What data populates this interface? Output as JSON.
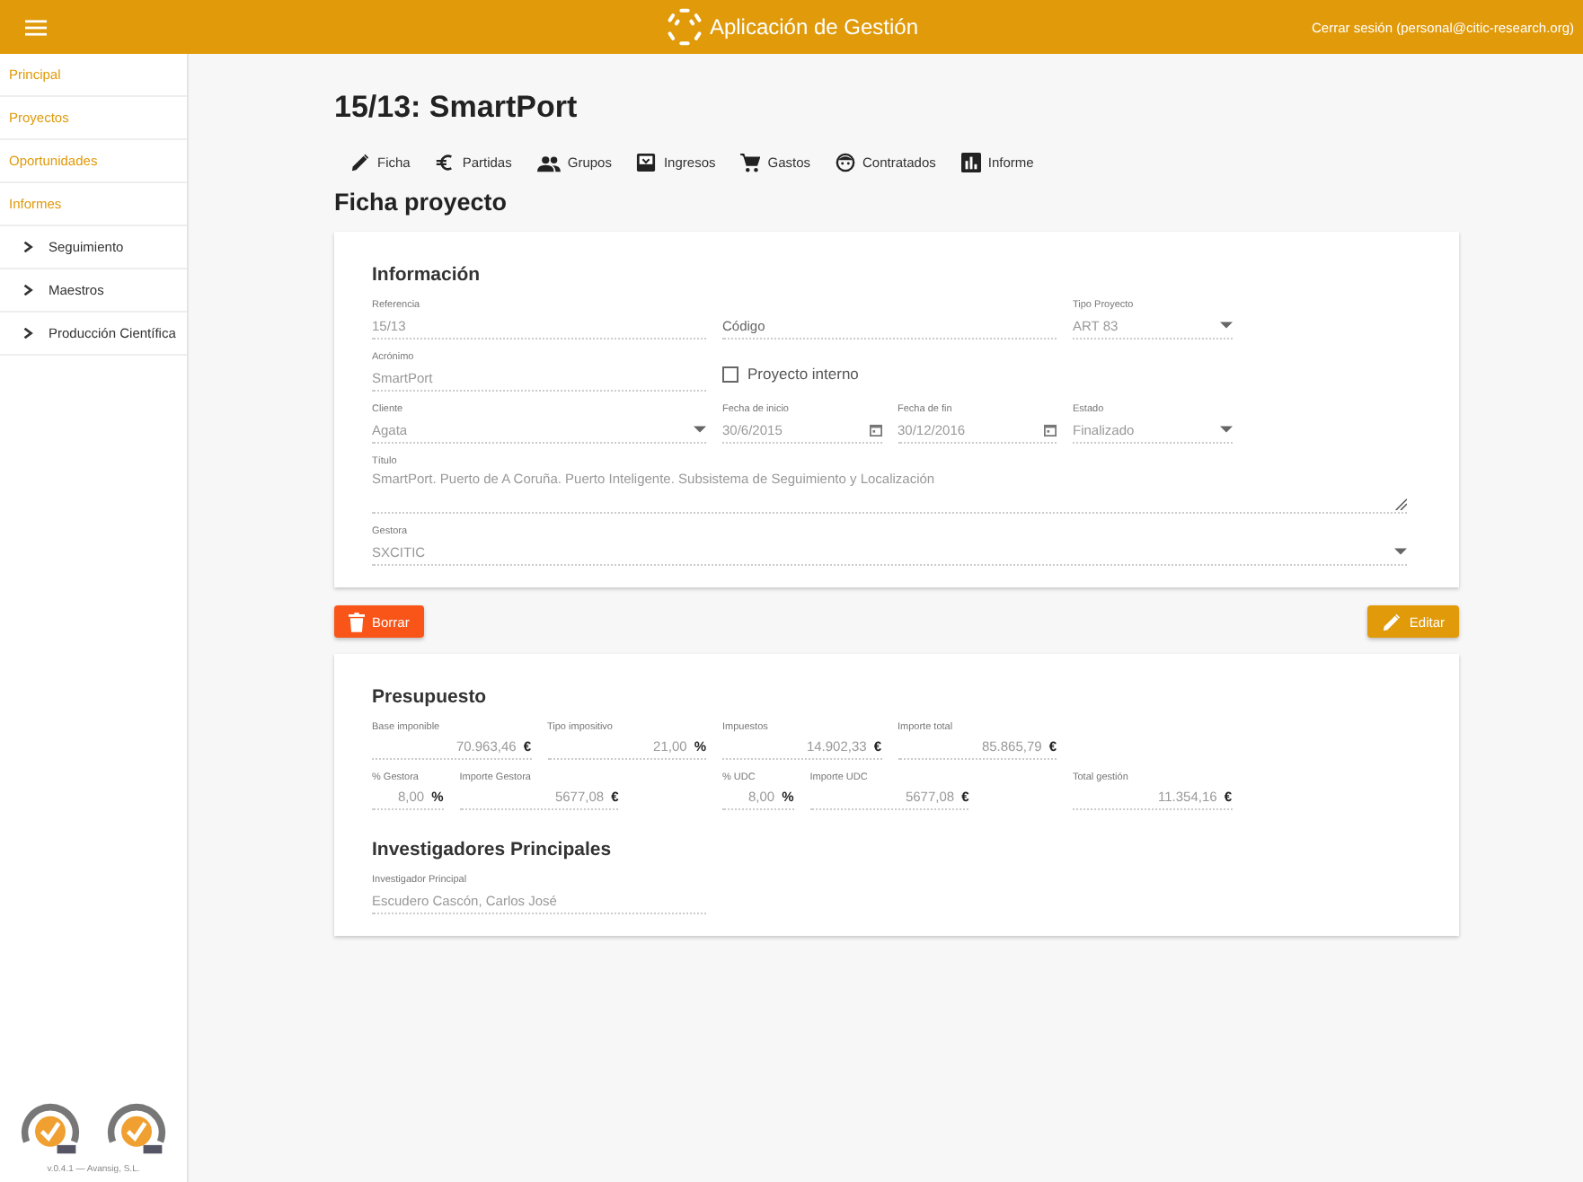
{
  "header": {
    "title": "Aplicación de Gestión",
    "logout": "Cerrar sesión (personal@citic-research.org)"
  },
  "sidebar": {
    "items": [
      {
        "label": "Principal"
      },
      {
        "label": "Proyectos"
      },
      {
        "label": "Oportunidades"
      },
      {
        "label": "Informes",
        "children": [
          {
            "label": "Seguimiento",
            "expanded": false
          },
          {
            "label": "Maestros",
            "expanded": false
          },
          {
            "label": "Producción Científica",
            "expanded": false
          }
        ]
      }
    ],
    "footer": "v.0.4.1 — Avansig, S.L."
  },
  "page_title": "15/13: SmartPort",
  "tabs": [
    {
      "label": "Ficha",
      "kind": "pencil"
    },
    {
      "label": "Partidas",
      "kind": "euro"
    },
    {
      "label": "Grupos",
      "kind": "group"
    },
    {
      "label": "Ingresos",
      "kind": "inbox"
    },
    {
      "label": "Gastos",
      "kind": "cart"
    },
    {
      "label": "Contratados",
      "kind": "face"
    },
    {
      "label": "Informe",
      "kind": "chart"
    }
  ],
  "section_title": "Ficha proyecto",
  "info": {
    "title": "Información",
    "fields": [
      {
        "kind": "text",
        "label": "Referencia",
        "value": "15/13"
      },
      {
        "kind": "text",
        "placeholder": "Código"
      },
      {
        "kind": "select",
        "label": "Tipo Proyecto",
        "value": "ART 83"
      },
      {
        "kind": "text",
        "label": "Acrónimo",
        "value": "SmartPort"
      },
      {
        "kind": "checkbox",
        "label": "Proyecto interno",
        "checked": false
      },
      {
        "kind": "select",
        "label": "Cliente",
        "value": "Agata"
      },
      {
        "kind": "date",
        "label": "Fecha de inicio",
        "value": "30/6/2015"
      },
      {
        "kind": "date",
        "label": "Fecha de fin",
        "value": "30/12/2016"
      },
      {
        "kind": "select",
        "label": "Estado",
        "value": "Finalizado"
      },
      {
        "kind": "textarea",
        "label": "Título",
        "value": "SmartPort. Puerto de A Coruña. Puerto Inteligente. Subsistema de Seguimiento y Localización"
      },
      {
        "kind": "select",
        "label": "Gestora",
        "value": "SXCITIC"
      }
    ]
  },
  "buttons": {
    "delete": "Borrar",
    "edit": "Editar"
  },
  "budget": {
    "title": "Presupuesto",
    "fields": [
      {
        "label": "Base imponible",
        "value": "70.963,46",
        "unit": "€"
      },
      {
        "label": "Tipo impositivo",
        "value": "21,00",
        "unit": "%"
      },
      {
        "label": "Impuestos",
        "value": "14.902,33",
        "unit": "€"
      },
      {
        "label": "Importe total",
        "value": "85.865,79",
        "unit": "€"
      },
      {
        "label": "% Gestora",
        "value": "8,00",
        "unit": "%"
      },
      {
        "label": "Importe Gestora",
        "value": "5677,08",
        "unit": "€"
      },
      {
        "label": "% UDC",
        "value": "8,00",
        "unit": "%"
      },
      {
        "label": "Importe UDC",
        "value": "5677,08",
        "unit": "€"
      },
      {
        "label": "Total gestión",
        "value": "11.354,16",
        "unit": "€"
      }
    ]
  },
  "investigators": {
    "title": "Investigadores Principales",
    "fields": [
      {
        "label": "Investigador Principal",
        "value": "Escudero Cascón, Carlos José"
      }
    ]
  }
}
